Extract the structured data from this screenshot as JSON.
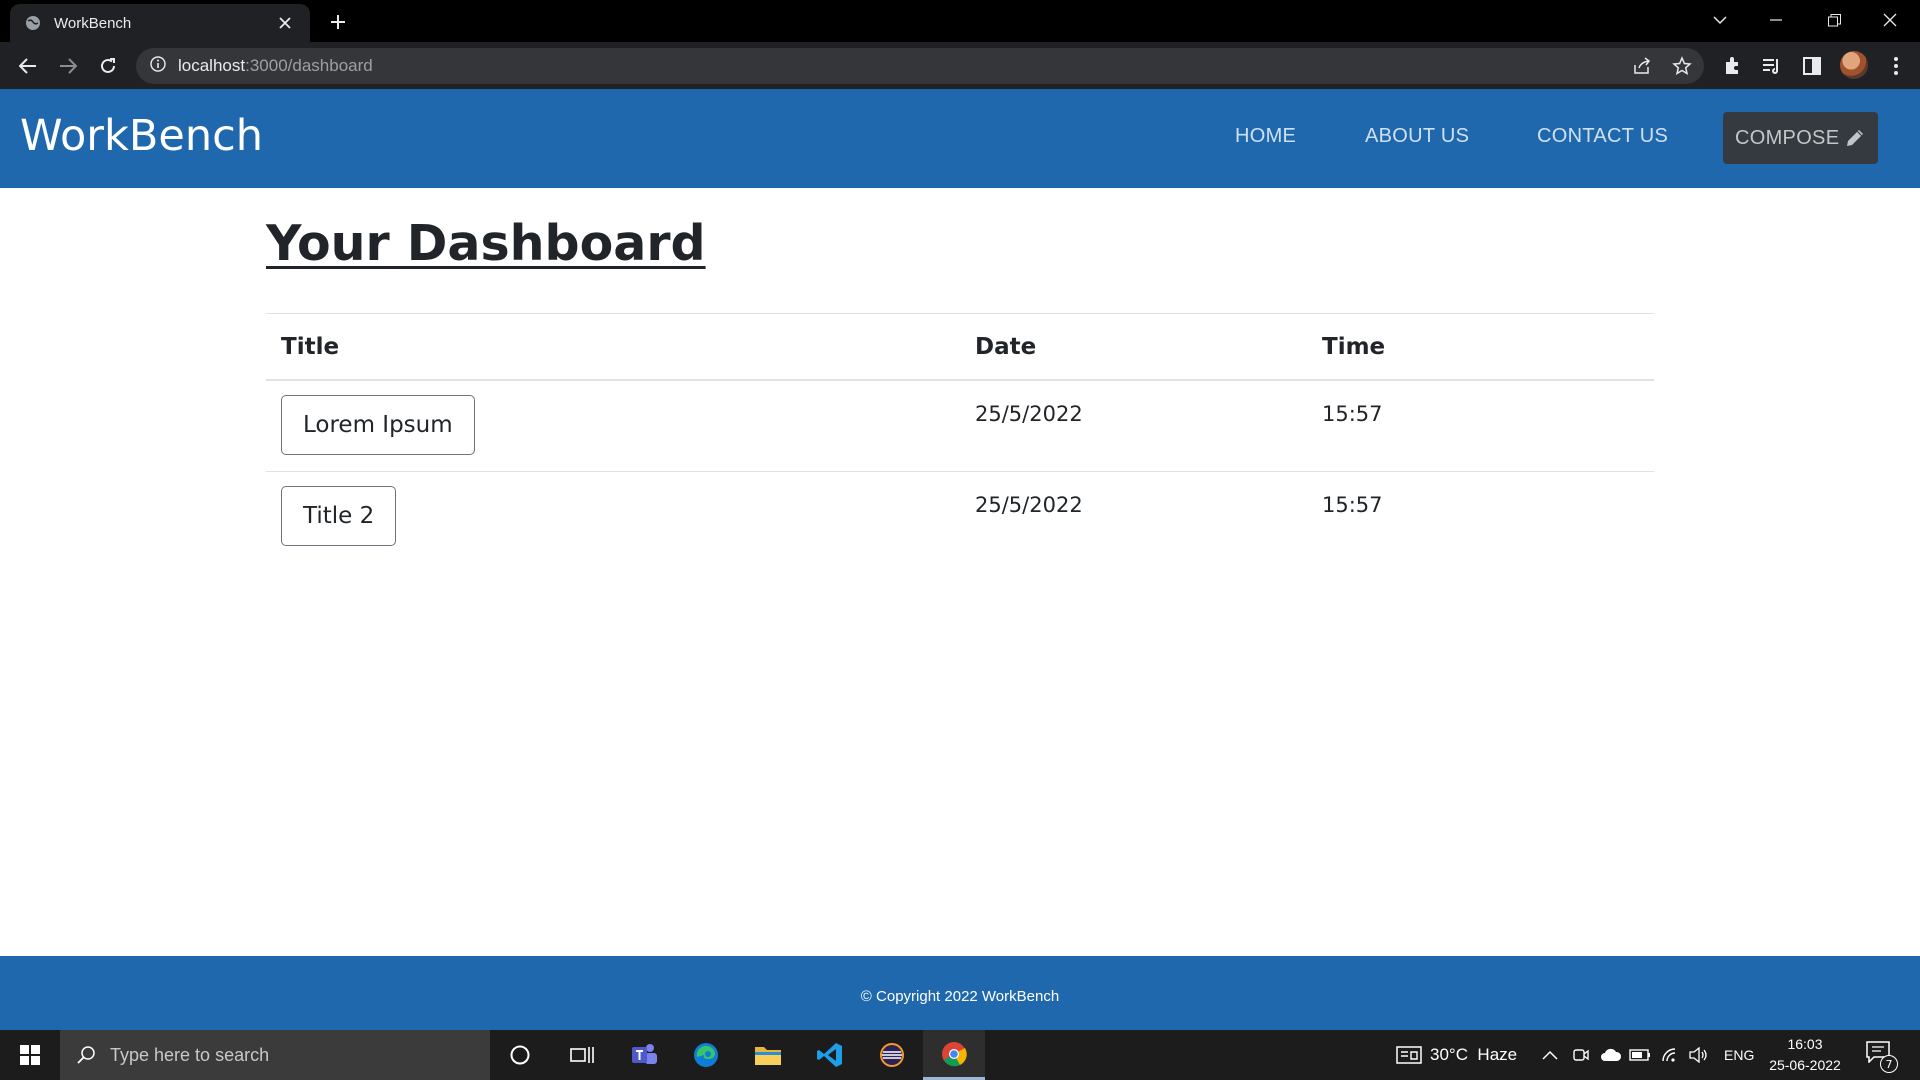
{
  "browser": {
    "tab_title": "WorkBench",
    "url_host": "localhost",
    "url_path": ":3000/dashboard"
  },
  "navbar": {
    "brand": "WorkBench",
    "links": [
      "HOME",
      "ABOUT US",
      "CONTACT US"
    ],
    "compose_label": "COMPOSE"
  },
  "main": {
    "heading": "Your Dashboard",
    "table": {
      "headers": [
        "Title",
        "Date",
        "Time"
      ],
      "rows": [
        {
          "title": "Lorem Ipsum",
          "date": "25/5/2022",
          "time": "15:57"
        },
        {
          "title": "Title 2",
          "date": "25/5/2022",
          "time": "15:57"
        }
      ]
    }
  },
  "footer": {
    "text": "© Copyright 2022 WorkBench"
  },
  "taskbar": {
    "search_placeholder": "Type here to search",
    "weather": "30°C  Haze",
    "language": "ENG",
    "time": "16:03",
    "date": "25-06-2022",
    "notification_count": "7"
  },
  "colors": {
    "navbar_bg": "#1f68ad",
    "compose_bg": "#343a40",
    "footer_bg": "#1f68ad"
  }
}
